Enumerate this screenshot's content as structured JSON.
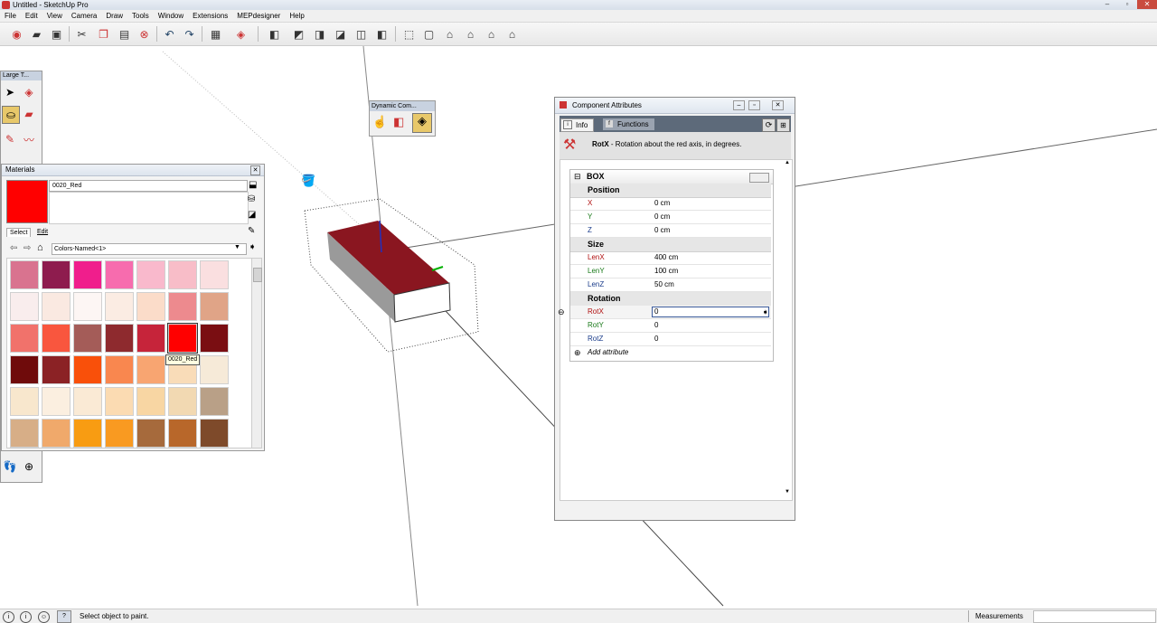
{
  "window": {
    "title": "Untitled - SketchUp Pro"
  },
  "menu": [
    "File",
    "Edit",
    "View",
    "Camera",
    "Draw",
    "Tools",
    "Window",
    "Extensions",
    "MEPdesigner",
    "Help"
  ],
  "tool_palette": {
    "title": "Large T..."
  },
  "materials": {
    "title": "Materials",
    "current_name": "0020_Red",
    "current_color": "#ff0000",
    "tabs": [
      "Select",
      "Edit"
    ],
    "collection": "Colors-Named<1>",
    "tooltip": "0020_Red",
    "swatches": [
      "#d9738f",
      "#8e1c4e",
      "#f01e8c",
      "#f76cae",
      "#f9b9cc",
      "#f8bdc8",
      "#fadfe0",
      "#f9eded",
      "#fae9e1",
      "#fdf6f4",
      "#fbece3",
      "#fbdcc9",
      "#ed8a8e",
      "#e0a487",
      "#f1726b",
      "#f9563e",
      "#a45c58",
      "#8e2a2e",
      "#c6243a",
      "#ff0000",
      "#7a0e12",
      "#6f0b0b",
      "#8b2225",
      "#f9500a",
      "#f9874f",
      "#f8a571",
      "#f9dcb8",
      "#f6ead8",
      "#f8e7cd",
      "#fbefe0",
      "#faead5",
      "#fbdbb2",
      "#f8d6a3",
      "#f2d9b2",
      "#b9a087",
      "#d7ae87",
      "#f0a96b",
      "#f89c12",
      "#f99a21",
      "#a66a3c",
      "#b8672a",
      "#7e4a2a"
    ]
  },
  "dynamic_components": {
    "title": "Dynamic Com..."
  },
  "component_attributes": {
    "title": "Component Attributes",
    "tabs": [
      "Info",
      "Functions"
    ],
    "hint_name": "RotX",
    "hint_text": " - Rotation about the red axis, in degrees.",
    "component_name": "BOX",
    "groups": [
      {
        "name": "Position",
        "rows": [
          {
            "n": "X",
            "v": "0 cm"
          },
          {
            "n": "Y",
            "v": "0 cm"
          },
          {
            "n": "Z",
            "v": "0 cm"
          }
        ]
      },
      {
        "name": "Size",
        "rows": [
          {
            "n": "LenX",
            "v": "400 cm"
          },
          {
            "n": "LenY",
            "v": "100 cm"
          },
          {
            "n": "LenZ",
            "v": "50 cm"
          }
        ]
      },
      {
        "name": "Rotation",
        "rows": [
          {
            "n": "RotX",
            "v": "0"
          },
          {
            "n": "RotY",
            "v": "0"
          },
          {
            "n": "RotZ",
            "v": "0"
          }
        ]
      }
    ],
    "add_attribute": "Add attribute"
  },
  "status": {
    "message": "Select object to paint.",
    "measurements_label": "Measurements"
  },
  "colors": {
    "red_axis": "#c00000",
    "green_axis": "#00a000",
    "blue_axis": "#0000c0",
    "box_top": "#8a1620"
  },
  "icons": [
    "paint-bucket-icon",
    "select-arrow-icon",
    "eraser-icon",
    "pencil-icon",
    "home-icon",
    "refresh-icon"
  ]
}
